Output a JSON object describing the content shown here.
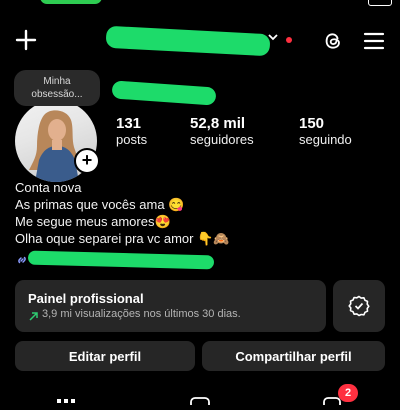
{
  "status_bar": {
    "right_text": "⁞⁞ ᛫ ◠"
  },
  "header": {
    "new_post_icon": "plus-icon",
    "username_dropdown_icon": "chevron-down-icon",
    "threads_icon": "threads-icon",
    "menu_icon": "hamburger-menu-icon",
    "notification_dot_color": "#ff3040"
  },
  "profile": {
    "note": "Minha obsessão...",
    "stats": [
      {
        "value": "131",
        "label": "posts"
      },
      {
        "value": "52,8 mil",
        "label": "seguidores"
      },
      {
        "value": "150",
        "label": "seguindo"
      }
    ]
  },
  "bio": {
    "lines": [
      "Conta nova",
      "As primas que vocês ama 😋",
      "Me segue meus amores😍",
      "Olha oque separei pra vc amor 👇🙈"
    ]
  },
  "dashboard": {
    "title": "Painel profissional",
    "subtitle": "3,9 mi visualizações nos últimos 30 dias.",
    "trend_color": "#2ecc71"
  },
  "actions": {
    "edit": "Editar perfil",
    "share": "Compartilhar perfil"
  },
  "bottom_nav": {
    "badge_count": "2",
    "badge_color": "#ff3040"
  }
}
